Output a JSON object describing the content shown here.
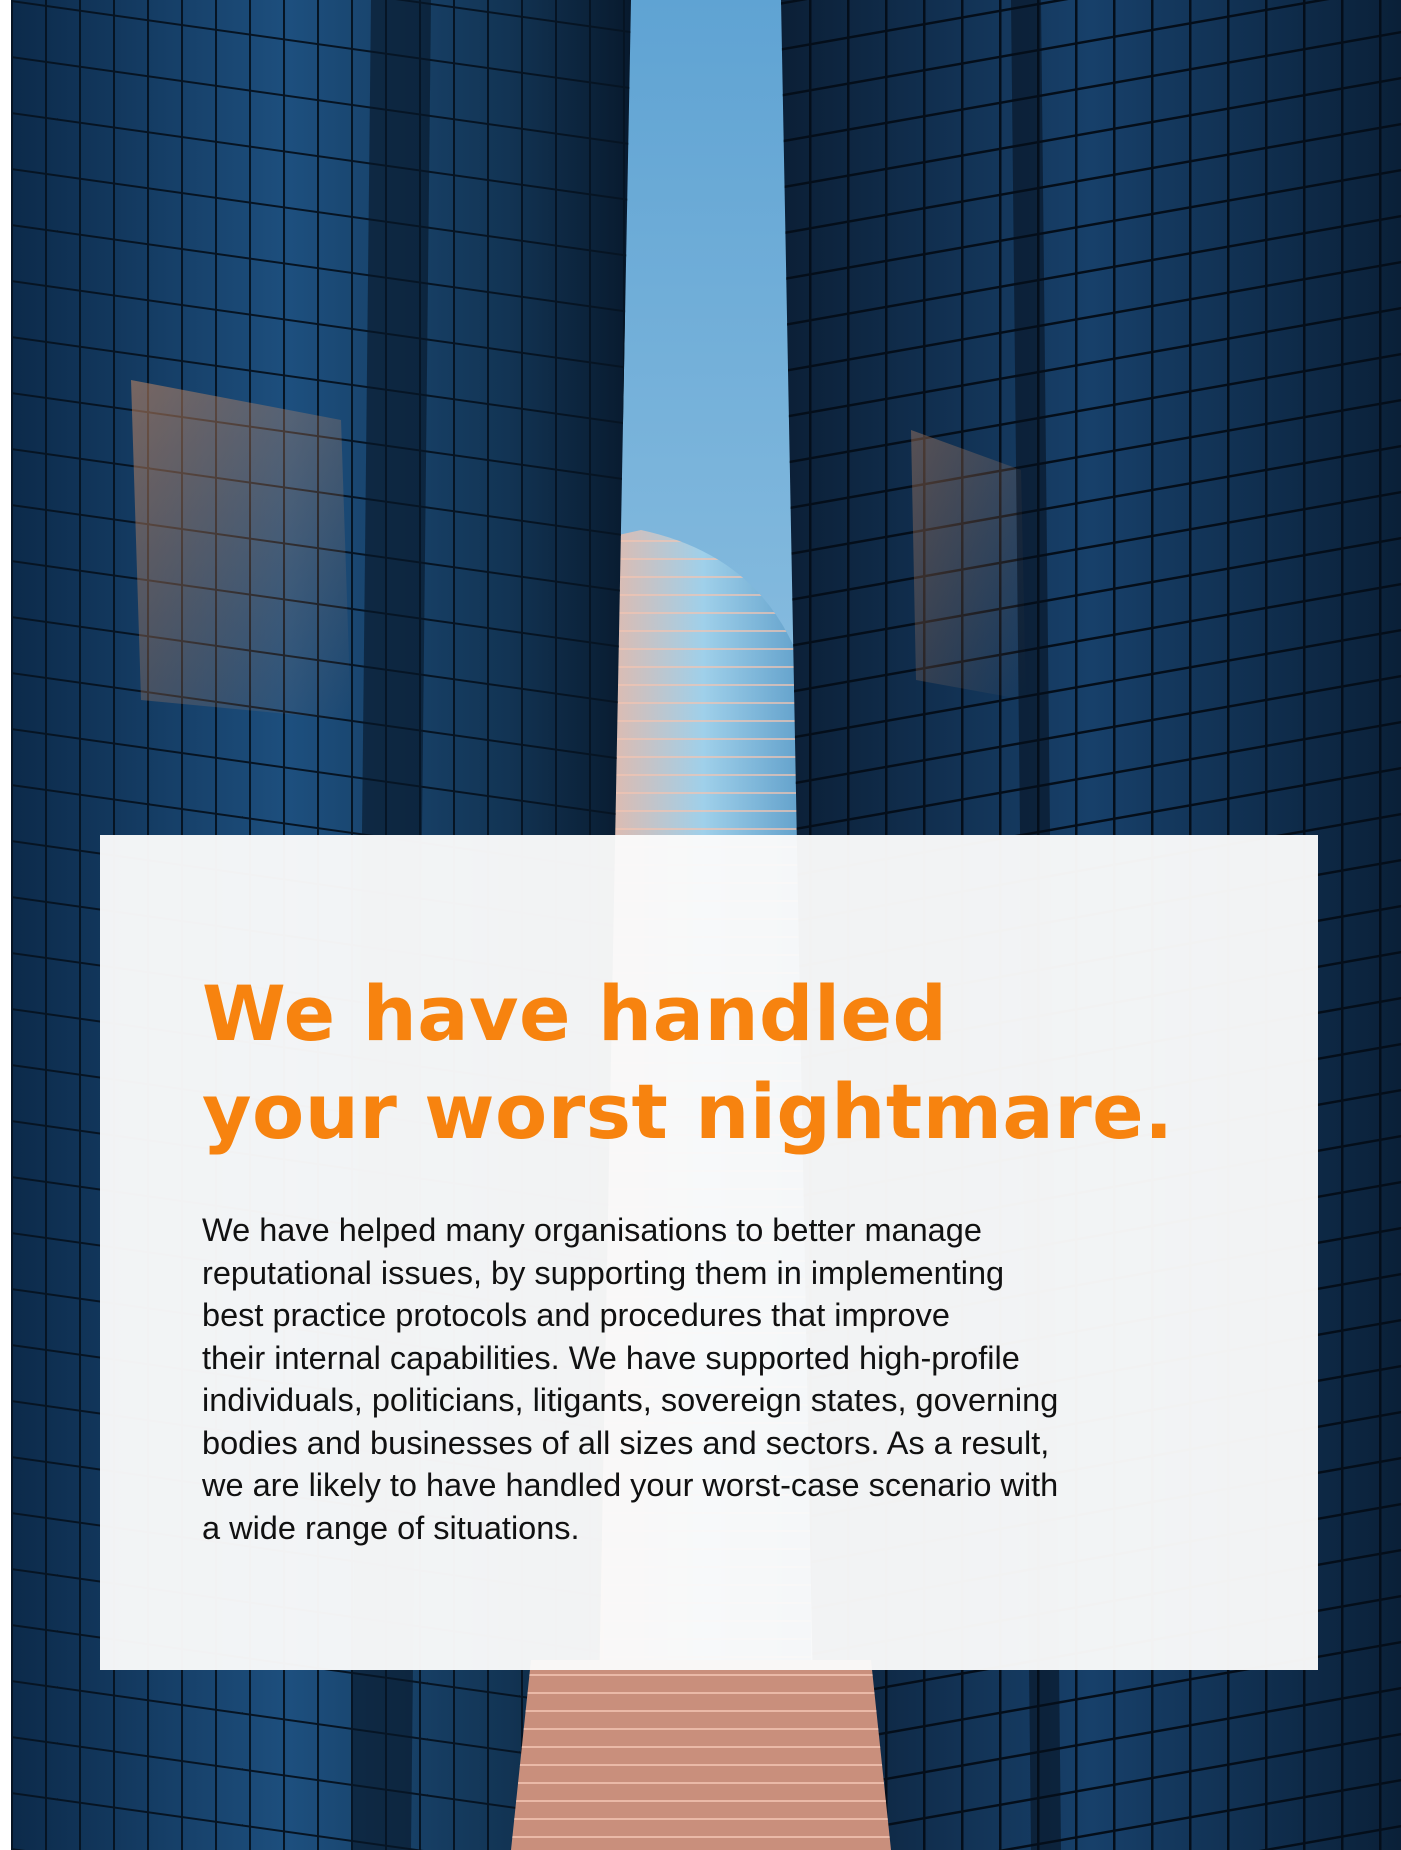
{
  "colors": {
    "accent": "#f7830f",
    "body_text": "#111111",
    "card_background": "#fafafa",
    "sky": "#8ec2e6",
    "building_dark": "#0d2744"
  },
  "hero_image": {
    "subject": "skyscrapers-icon"
  },
  "headline": {
    "line1": "We have handled",
    "line2": "your worst nightmare."
  },
  "body": {
    "lines": [
      "We have helped many organisations to better manage",
      "reputational issues, by supporting them in implementing",
      "best practice protocols and procedures that improve",
      "their internal capabilities. We have supported high-profile",
      "individuals, politicians, litigants, sovereign states, governing",
      "bodies and businesses of all sizes and sectors. As a result,",
      "we are likely to have handled your worst-case scenario with",
      "a wide range of situations."
    ]
  }
}
